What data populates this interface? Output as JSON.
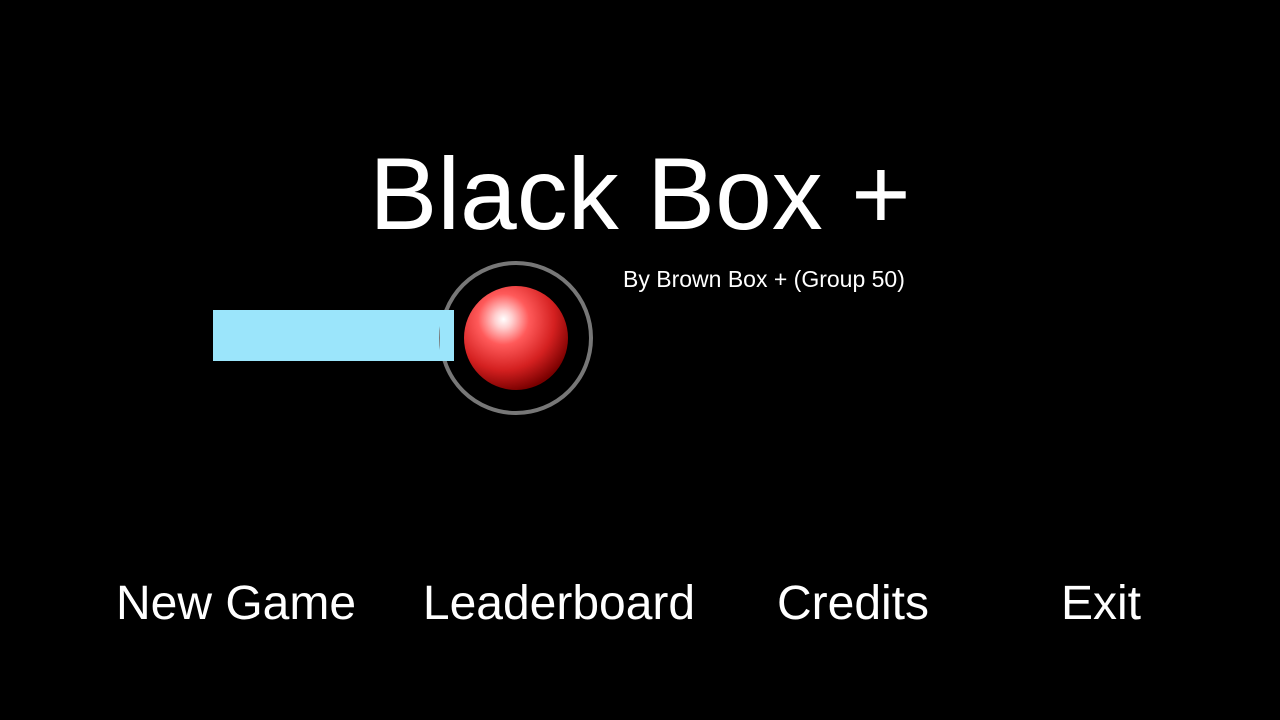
{
  "game": {
    "title": "Black Box +",
    "subtitle": "By Brown Box + (Group 50)"
  },
  "menu": {
    "new_game": "New Game",
    "leaderboard": "Leaderboard",
    "credits": "Credits",
    "exit": "Exit"
  },
  "colors": {
    "background": "#000000",
    "text": "#ffffff",
    "beam": "#9be5fb",
    "ring": "#7a7a7a",
    "ball": "#e23a3a"
  },
  "icons": {
    "logo": "laser-beam-into-red-ball-logo"
  }
}
